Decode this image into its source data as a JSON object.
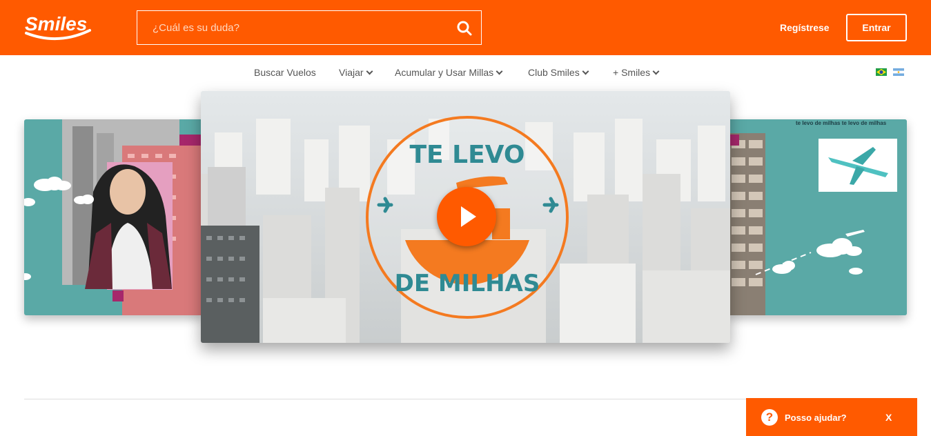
{
  "brand": {
    "name": "Smiles",
    "accent": "#ff5a00",
    "teal": "#5aa9a6"
  },
  "header": {
    "search_placeholder": "¿Cuál es su duda?",
    "search_icon": "search-icon",
    "register_label": "Regístrese",
    "login_label": "Entrar"
  },
  "nav": {
    "items": [
      {
        "label": "Buscar Vuelos",
        "has_dropdown": false
      },
      {
        "label": "Viajar",
        "has_dropdown": true
      },
      {
        "label": "Acumular y Usar Millas",
        "has_dropdown": true
      },
      {
        "label": "Club Smiles",
        "has_dropdown": true
      },
      {
        "label": "+ Smiles",
        "has_dropdown": true
      }
    ],
    "flags": [
      "brazil-flag-icon",
      "argentina-flag-icon"
    ]
  },
  "carousel": {
    "center_slide": {
      "badge_top": "TE LEVO",
      "badge_bottom": "DE MILHAS",
      "play_icon": "play-icon"
    },
    "right_slide": {
      "pattern_text": "te levo de milhas te levo de milhas"
    }
  },
  "help_widget": {
    "label": "Posso ajudar?",
    "close_label": "X"
  }
}
